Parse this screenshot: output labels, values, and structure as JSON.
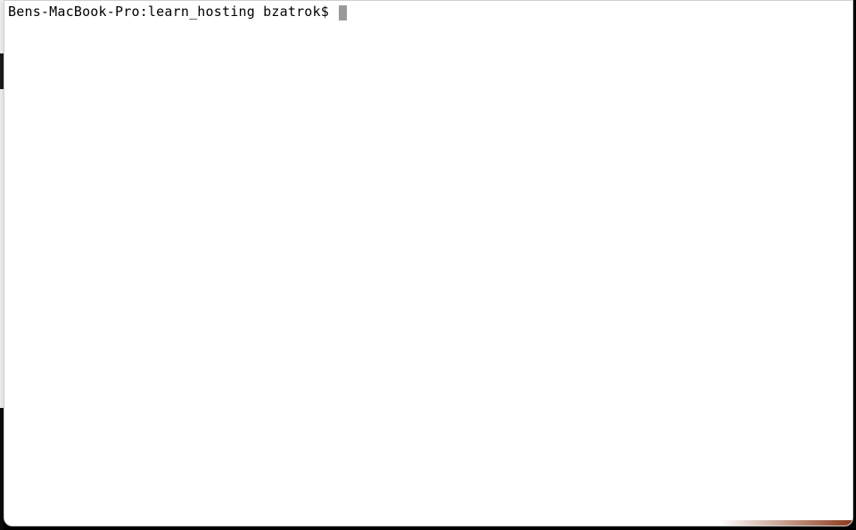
{
  "terminal": {
    "prompt": "Bens-MacBook-Pro:learn_hosting bzatrok$ ",
    "hostname": "Bens-MacBook-Pro",
    "directory": "learn_hosting",
    "user": "bzatrok",
    "command": ""
  }
}
